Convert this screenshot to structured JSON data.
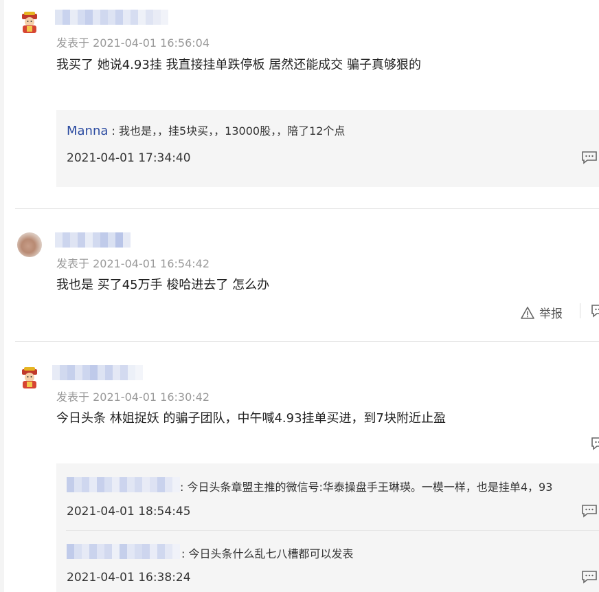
{
  "comments": [
    {
      "meta": "发表于 2021-04-01 16:56:04",
      "text": "我买了 她说4.93挂 我直接挂单跌停板 居然还能成交 骗子真够狠的",
      "replies": [
        {
          "user": "Manna",
          "text": " : 我也是，，挂5块买，，13000股，，陪了12个点",
          "time": "2021-04-01 17:34:40"
        }
      ]
    },
    {
      "meta": "发表于 2021-04-01 16:54:42",
      "text": "我也是 买了45万手 梭哈进去了 怎么办",
      "report_label": "举报"
    },
    {
      "meta": "发表于 2021-04-01 16:30:42",
      "text": "今日头条 林姐捉妖 的骗子团队，中午喊4.93挂单买进，到7块附近止盈",
      "replies": [
        {
          "text": ": 今日头条章盟主推的微信号:华泰操盘手王琳瑛。一模一样，也是挂单4，93",
          "time": "2021-04-01 18:54:45"
        },
        {
          "text": ": 今日头条什么乱七八槽都可以发表",
          "time": "2021-04-01 16:38:24"
        }
      ]
    }
  ],
  "colors": {
    "username_blue": "#2a4aa0",
    "meta_gray": "#999999",
    "reply_bg": "#f5f5f5"
  },
  "icons": [
    "god-of-wealth-avatar",
    "photo-avatar",
    "comment-bubble-icon",
    "warning-triangle-icon"
  ]
}
